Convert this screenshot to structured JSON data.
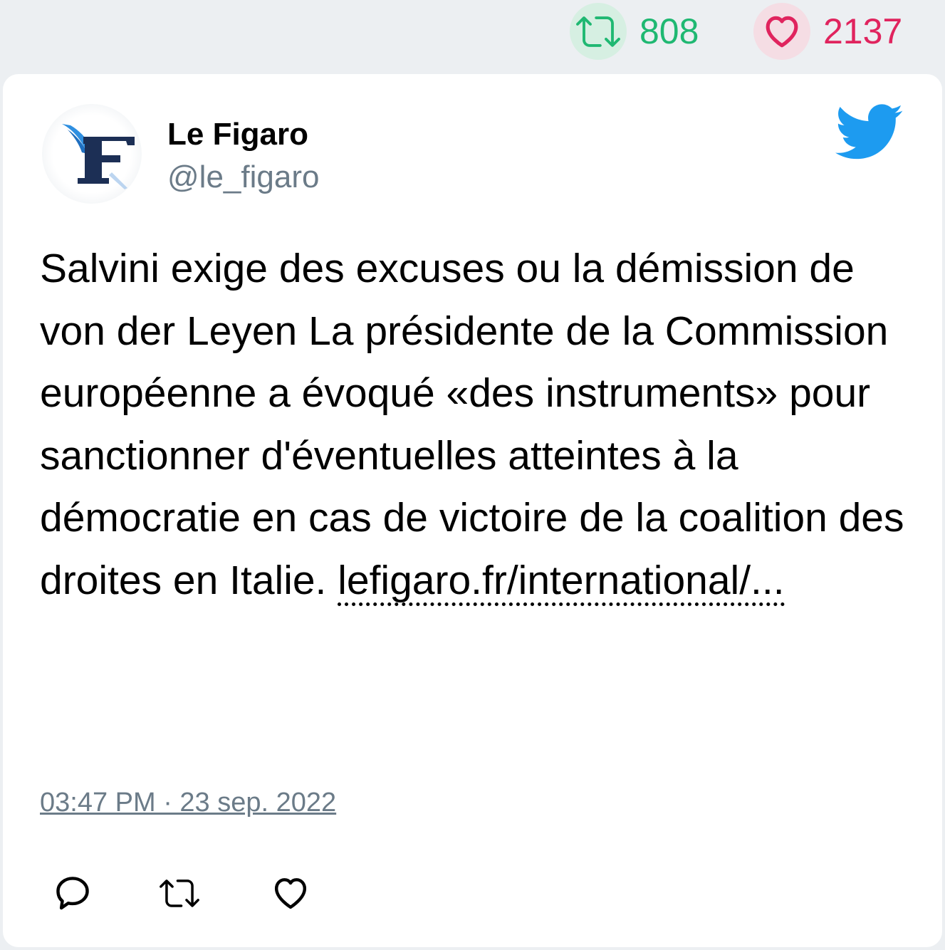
{
  "stats": {
    "retweets": "808",
    "likes": "2137",
    "retweet_color": "#1fb872",
    "like_color": "#e0245e"
  },
  "tweet": {
    "author_name": "Le Figaro",
    "author_handle": "@le_figaro",
    "avatar_icon": "le-figaro-logo",
    "brand_icon": "twitter-bird-icon",
    "brand_color": "#1d9bf0",
    "text": "Salvini exige des excuses ou la démission de von der Leyen La présidente de la Commission européenne a évoqué «des instruments» pour sanctionner d'éventuelles atteintes à la démocratie en cas de victoire de la coalition des droites en Italie. ",
    "link": "lefigaro.fr/international/...",
    "timestamp": "03:47 PM · 23 sep. 2022"
  },
  "actions": [
    {
      "icon": "reply-icon"
    },
    {
      "icon": "retweet-icon"
    },
    {
      "icon": "like-icon"
    }
  ]
}
